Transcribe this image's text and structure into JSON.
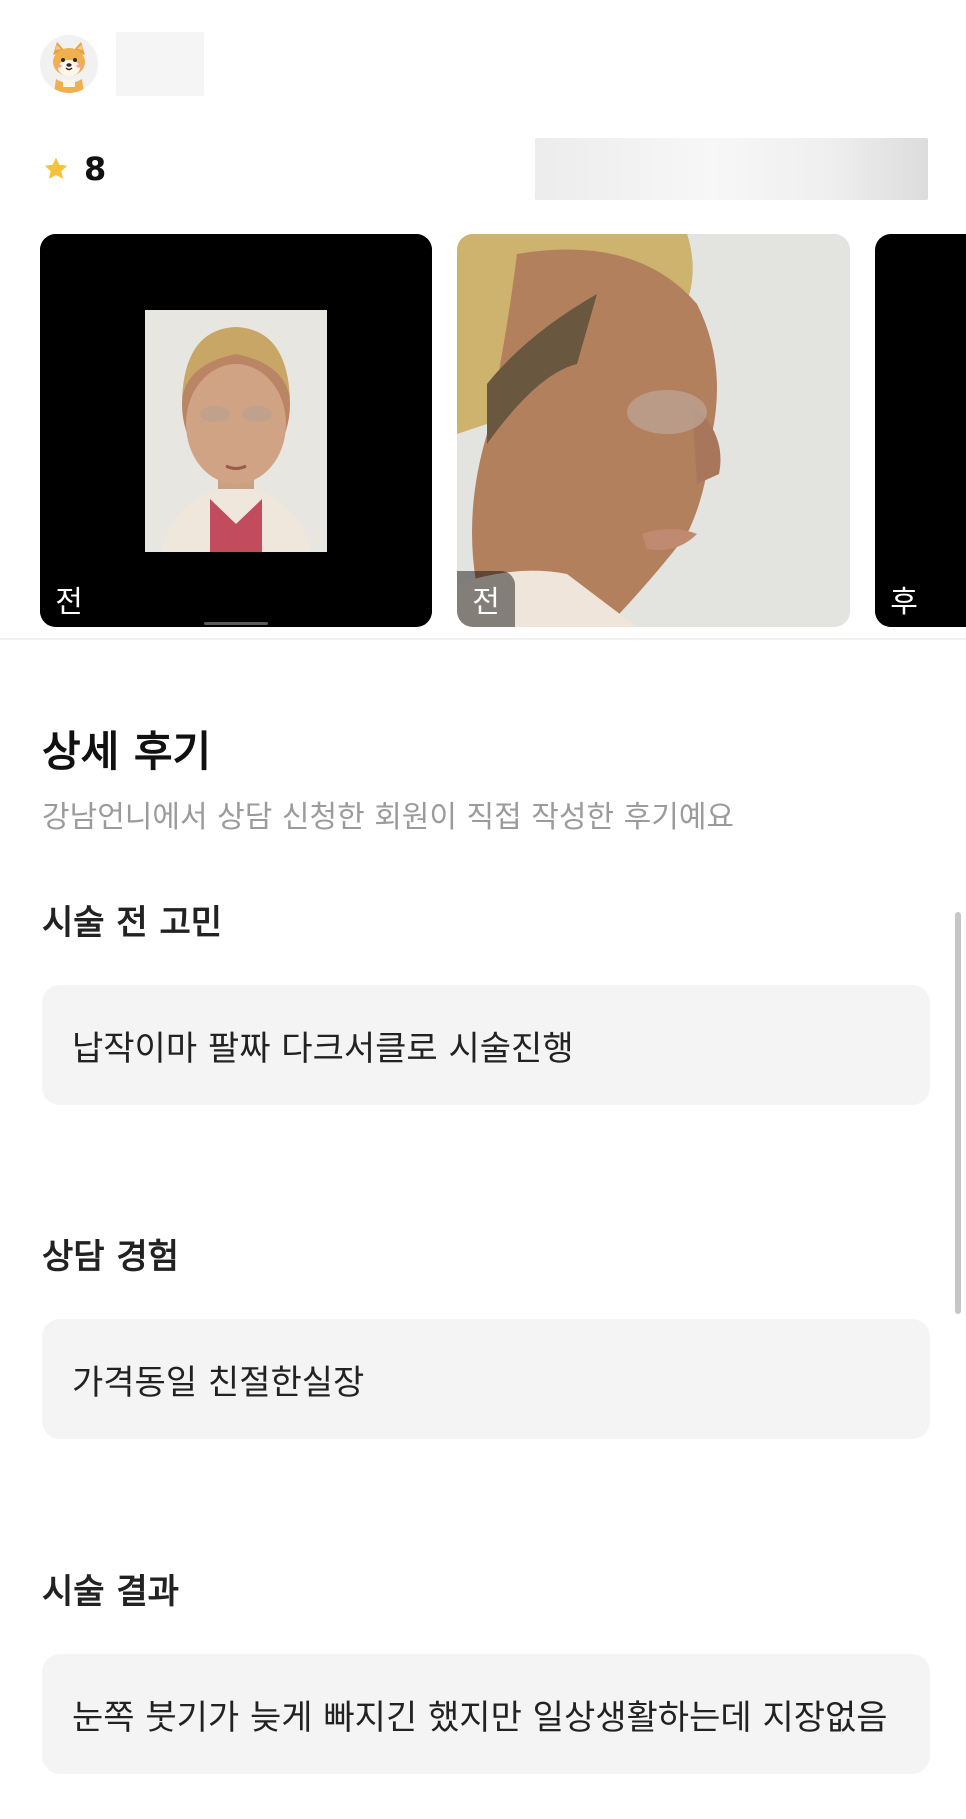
{
  "header": {
    "avatar_icon": "shiba-dog-avatar-icon"
  },
  "rating": {
    "icon": "star-icon",
    "value": "8",
    "star_color": "#F5C33B"
  },
  "photos": [
    {
      "tag": "전"
    },
    {
      "tag": "전"
    },
    {
      "tag": "후"
    }
  ],
  "detail_review": {
    "title": "상세 후기",
    "subtitle": "강남언니에서 상담 신청한 회원이 직접 작성한 후기예요"
  },
  "questions": [
    {
      "title": "시술 전 고민",
      "answer": "납작이마 팔짜 다크서클로 시술진행"
    },
    {
      "title": "상담 경험",
      "answer": "가격동일 친절한실장"
    },
    {
      "title": "시술 결과",
      "answer": "눈쪽 붓기가 늦게 빠지긴 했지만 일상생활하는데 지장없음"
    }
  ]
}
